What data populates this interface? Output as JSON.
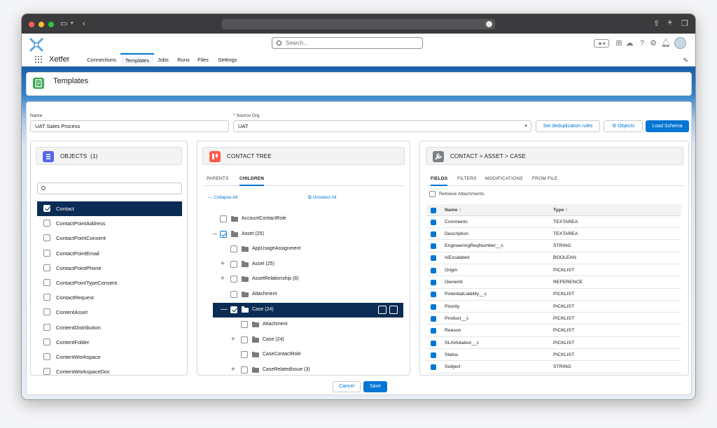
{
  "browser": {
    "back_icon": "chevron-left-icon",
    "sidebar_icon": "sidebar-icon",
    "share_icon": "share-icon",
    "new_tab_icon": "plus-icon",
    "tabs_icon": "tabs-icon"
  },
  "header": {
    "search_placeholder": "Search...",
    "app_name": "Xetfer",
    "icons": [
      "favorites-icon",
      "add-icon",
      "cloud-icon",
      "help-icon",
      "setup-icon",
      "bell-icon",
      "avatar"
    ]
  },
  "nav": [
    {
      "label": "Connections",
      "active": false
    },
    {
      "label": "Templates",
      "active": true
    },
    {
      "label": "Jobs",
      "active": false
    },
    {
      "label": "Runs",
      "active": false
    },
    {
      "label": "Files",
      "active": false
    },
    {
      "label": "Settings",
      "active": false
    }
  ],
  "page": {
    "title": "Templates"
  },
  "form": {
    "name_label": "Name",
    "name_value": "UAT Sales Process",
    "source_required": "*",
    "source_label": "Source Org",
    "source_value": "UAT",
    "dedupe_button": "Set deduplication rules",
    "objects_button": "Objects",
    "load_button": "Load Schema"
  },
  "objects": {
    "title": "OBJECTS",
    "count": "(1)",
    "items": [
      {
        "label": "Contact",
        "checked": true
      },
      {
        "label": "ContactPointAddress",
        "checked": false
      },
      {
        "label": "ContactPointConsent",
        "checked": false
      },
      {
        "label": "ContactPointEmail",
        "checked": false
      },
      {
        "label": "ContactPointPhone",
        "checked": false
      },
      {
        "label": "ContactPointTypeConsent",
        "checked": false
      },
      {
        "label": "ContactRequest",
        "checked": false
      },
      {
        "label": "ContentAsset",
        "checked": false
      },
      {
        "label": "ContentDistribution",
        "checked": false
      },
      {
        "label": "ContentFolder",
        "checked": false
      },
      {
        "label": "ContentWorkspace",
        "checked": false
      },
      {
        "label": "ContentWorkspaceDoc",
        "checked": false
      }
    ]
  },
  "tree": {
    "title": "CONTACT TREE",
    "tabs": [
      "PARENTS",
      "CHILDREN"
    ],
    "collapse_all": "Collapse All",
    "unselect_all": "Unselect All",
    "rows": [
      {
        "label": "AccountContactRole",
        "level": 0,
        "checked": false,
        "toggle": ""
      },
      {
        "label": "Asset (25)",
        "level": 0,
        "checked": true,
        "toggle": "—"
      },
      {
        "label": "AppUsageAssignment",
        "level": 1,
        "checked": false,
        "toggle": ""
      },
      {
        "label": "Asset (25)",
        "level": 1,
        "checked": false,
        "toggle": "+"
      },
      {
        "label": "AssetRelationship (8)",
        "level": 1,
        "checked": false,
        "toggle": "+"
      },
      {
        "label": "Attachment",
        "level": 1,
        "checked": false,
        "toggle": ""
      },
      {
        "label": "Case (24)",
        "level": 1,
        "checked": true,
        "toggle": "—",
        "highlight": true
      },
      {
        "label": "Attachment",
        "level": 2,
        "checked": false,
        "toggle": ""
      },
      {
        "label": "Case (24)",
        "level": 2,
        "checked": false,
        "toggle": "+"
      },
      {
        "label": "CaseContactRole",
        "level": 2,
        "checked": false,
        "toggle": ""
      },
      {
        "label": "CaseRelatedIssue (3)",
        "level": 2,
        "checked": false,
        "toggle": "+"
      }
    ]
  },
  "fields_panel": {
    "title": "CONTACT > ASSET > CASE",
    "tabs": [
      "FIELDS",
      "FILTERS",
      "MODIFICATIONS",
      "FROM FILE"
    ],
    "retrieve": "Retrieve Attachments",
    "col_name": "Name",
    "col_type": "Type",
    "sort_glyph": "↑",
    "rows": [
      {
        "name": "Comments",
        "type": "TEXTAREA"
      },
      {
        "name": "Description",
        "type": "TEXTAREA"
      },
      {
        "name": "EngineeringReqNumber__c",
        "type": "STRING"
      },
      {
        "name": "IsEscalated",
        "type": "BOOLEAN"
      },
      {
        "name": "Origin",
        "type": "PICKLIST"
      },
      {
        "name": "OwnerId",
        "type": "REFERENCE"
      },
      {
        "name": "PotentialLiability__c",
        "type": "PICKLIST"
      },
      {
        "name": "Priority",
        "type": "PICKLIST"
      },
      {
        "name": "Product__c",
        "type": "PICKLIST"
      },
      {
        "name": "Reason",
        "type": "PICKLIST"
      },
      {
        "name": "SLAViolation__c",
        "type": "PICKLIST"
      },
      {
        "name": "Status",
        "type": "PICKLIST"
      },
      {
        "name": "Subject",
        "type": "STRING"
      }
    ]
  },
  "footer": {
    "cancel": "Cancel",
    "save": "Save"
  },
  "colors": {
    "brand": "#0176d3",
    "selected": "#0b2c54",
    "objects_icon": "#5867e8",
    "tree_icon": "#fe5c4c",
    "fields_icon": "#7b8087"
  }
}
